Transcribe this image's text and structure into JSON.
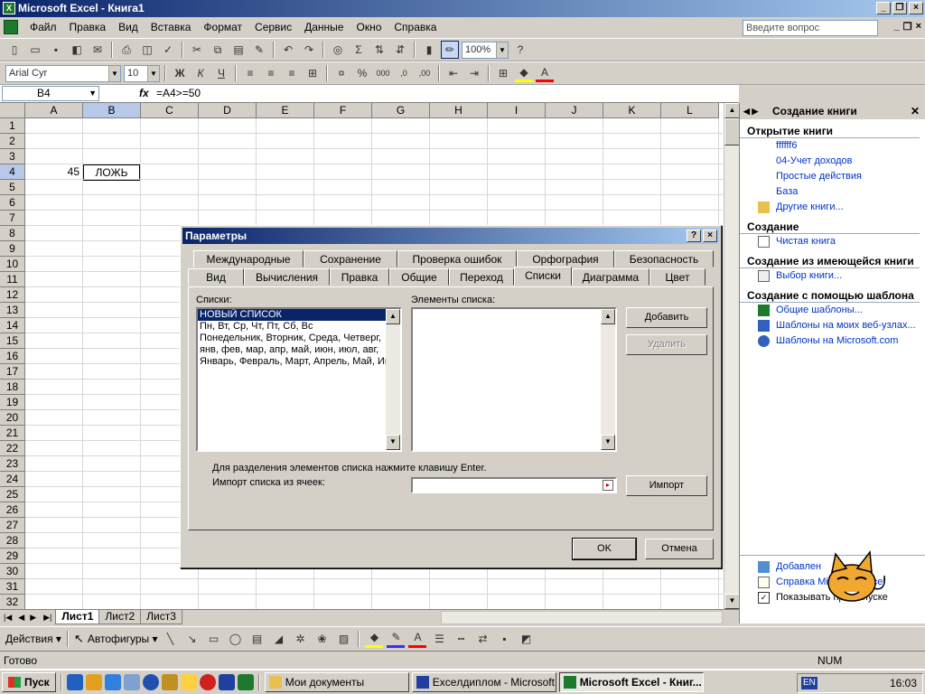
{
  "window": {
    "title": "Microsoft Excel - Книга1"
  },
  "menu": [
    "Файл",
    "Правка",
    "Вид",
    "Вставка",
    "Формат",
    "Сервис",
    "Данные",
    "Окно",
    "Справка"
  ],
  "ask": {
    "placeholder": "Введите вопрос"
  },
  "toolbar": {
    "zoom": "100%",
    "font": "Arial Cyr",
    "size": "10"
  },
  "formula_bar": {
    "name_box": "B4",
    "fx": "fx",
    "formula": "=A4>=50"
  },
  "grid": {
    "columns": [
      "A",
      "B",
      "C",
      "D",
      "E",
      "F",
      "G",
      "H",
      "I",
      "J",
      "K",
      "L"
    ],
    "rows": [
      "1",
      "2",
      "3",
      "4",
      "5",
      "6",
      "7",
      "8",
      "9",
      "10",
      "11",
      "12",
      "13",
      "14",
      "15",
      "16",
      "17",
      "18",
      "19",
      "20",
      "21",
      "22",
      "23",
      "24",
      "25",
      "26",
      "27",
      "28",
      "29",
      "30",
      "31",
      "32"
    ],
    "a4": "45",
    "b4": "ЛОЖЬ"
  },
  "sheets": [
    "Лист1",
    "Лист2",
    "Лист3"
  ],
  "drawing": {
    "actions": "Действия",
    "autoshapes": "Автофигуры"
  },
  "status": {
    "ready": "Готово",
    "num": "NUM"
  },
  "taskbar": {
    "start": "Пуск",
    "items": [
      "Мои документы",
      "Exceлдиплом - Microsoft...",
      "Microsoft Excel - Книг..."
    ],
    "lang": "EN",
    "time": "16:03"
  },
  "taskpane": {
    "title": "Создание книги",
    "open_section": "Открытие книги",
    "recent": [
      "ffffff6",
      "04-Учет доходов",
      "Простые действия",
      "База"
    ],
    "other_books": "Другие книги...",
    "create_section": "Создание",
    "blank": "Чистая книга",
    "existing_section": "Создание из имеющейся книги",
    "choose": "Выбор книги...",
    "template_section": "Создание с помощью шаблона",
    "templates": [
      "Общие шаблоны...",
      "Шаблоны на моих веб-узлах...",
      "Шаблоны на Microsoft.com"
    ],
    "footer": [
      "Добавлен",
      "Справка Microsoft Excel",
      "Показывать при запуске"
    ]
  },
  "dialog": {
    "title": "Параметры",
    "tabs_top": [
      "Международные",
      "Сохранение",
      "Проверка ошибок",
      "Орфография",
      "Безопасность"
    ],
    "tabs_bottom": [
      "Вид",
      "Вычисления",
      "Правка",
      "Общие",
      "Переход",
      "Списки",
      "Диаграмма",
      "Цвет"
    ],
    "lists_label": "Списки:",
    "elements_label": "Элементы списка:",
    "lists": [
      "НОВЫЙ СПИСОК",
      "Пн, Вт, Ср, Чт, Пт, Сб, Вс",
      "Понедельник, Вторник, Среда, Четверг,",
      "янв, фев, мар, апр, май, июн, июл, авг,",
      "Январь, Февраль, Март, Апрель, Май, Ию"
    ],
    "add": "Добавить",
    "delete": "Удалить",
    "hint": "Для разделения элементов списка нажмите клавишу Enter.",
    "import_label": "Импорт списка из ячеек:",
    "import": "Импорт",
    "ok": "OK",
    "cancel": "Отмена"
  },
  "colors": {
    "title_start": "#0a246a",
    "title_end": "#a6caf0",
    "link": "#0033cc"
  }
}
